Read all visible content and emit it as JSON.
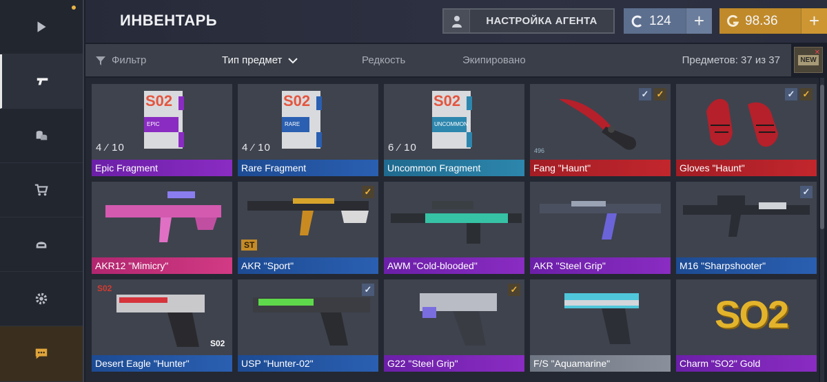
{
  "header": {
    "title": "ИНВЕНТАРЬ",
    "agent_button": "НАСТРОЙКА АГЕНТА",
    "silver": "124",
    "gold": "98.36",
    "plus": "+"
  },
  "filters": {
    "filter": "Фильтр",
    "type": "Тип предмет",
    "rarity": "Редкость",
    "equipped": "Экипировано",
    "count": "Предметов: 37 из 37",
    "new_badge": "NEW"
  },
  "colors": {
    "purple": "#7b25b6",
    "blue": "#2452a0",
    "teal": "#25779e",
    "red": "#b22128",
    "pink": "#c22f79",
    "gray": "#7c838f",
    "gold": "#c08a2a"
  },
  "sidebar": {
    "items": [
      "play-icon",
      "pistol-icon",
      "coins-icon",
      "cart-icon",
      "helmet-icon",
      "gear-icon",
      "chat-icon"
    ]
  },
  "items": [
    {
      "name": "Epic Fragment",
      "count": "4 ⁄ 10",
      "sticker": "S02",
      "sticker_label": "EPIC"
    },
    {
      "name": "Rare Fragment",
      "count": "4 ⁄ 10",
      "sticker": "S02",
      "sticker_label": "RARE"
    },
    {
      "name": "Uncommon Fragment",
      "count": "6 ⁄ 10",
      "sticker": "S02",
      "sticker_label": "UNCOMMON"
    },
    {
      "name": "Fang \"Haunt\"",
      "tag": "496"
    },
    {
      "name": "Gloves \"Haunt\""
    },
    {
      "name": "AKR12 \"Mimicry\""
    },
    {
      "name": "AKR \"Sport\"",
      "badge": "ST"
    },
    {
      "name": "AWM \"Cold-blooded\""
    },
    {
      "name": "AKR \"Steel Grip\""
    },
    {
      "name": "M16 \"Sharpshooter\""
    },
    {
      "name": "Desert Eagle \"Hunter\"",
      "tag_top": "S02",
      "tag_bottom": "S02"
    },
    {
      "name": "USP \"Hunter-02\""
    },
    {
      "name": "G22 \"Steel Grip\""
    },
    {
      "name": "F/S \"Aquamarine\""
    },
    {
      "name": "Charm \"SO2\" Gold",
      "charm": "SO2"
    }
  ]
}
